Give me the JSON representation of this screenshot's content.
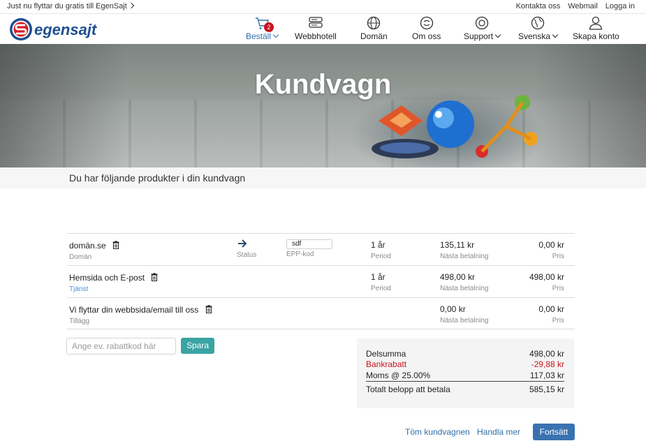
{
  "topbar": {
    "promo": "Just nu flyttar du gratis till EgenSajt",
    "links": [
      "Kontakta oss",
      "Webmail",
      "Logga in"
    ]
  },
  "brand": {
    "logo_text": "egensajt"
  },
  "nav": {
    "items": [
      {
        "label": "Beställ",
        "icon": "cart-icon",
        "badge": "2"
      },
      {
        "label": "Webbhotell",
        "icon": "server-icon"
      },
      {
        "label": "Domän",
        "icon": "globe-icon"
      },
      {
        "label": "Om oss",
        "icon": "chat-icon"
      },
      {
        "label": "Support",
        "icon": "lifebuoy-icon"
      },
      {
        "label": "Svenska",
        "icon": "world-icon"
      },
      {
        "label": "Skapa konto",
        "icon": "user-icon"
      }
    ]
  },
  "hero": {
    "title": "Kundvagn"
  },
  "subheader": "Du har följande produkter i din kundvagn",
  "cart": {
    "rows": [
      {
        "name": "domän.se",
        "type": "Domän",
        "status_label": "Status",
        "epp_value": "sdf",
        "epp_label": "EPP-kod",
        "period": "1 år",
        "period_label": "Period",
        "next_payment": "135,11 kr",
        "next_payment_label": "Nästa betalning",
        "price": "0,00 kr",
        "price_label": "Pris"
      },
      {
        "name": "Hemsida och E-post",
        "type": "Tjänst",
        "period": "1 år",
        "period_label": "Period",
        "next_payment": "498,00 kr",
        "next_payment_label": "Nästa betalning",
        "price": "498,00 kr",
        "price_label": "Pris"
      },
      {
        "name": "Vi flyttar din webbsida/email till oss",
        "type": "Tillägg",
        "next_payment": "0,00 kr",
        "next_payment_label": "Nästa betalning",
        "price": "0,00 kr",
        "price_label": "Pris"
      }
    ]
  },
  "discount": {
    "placeholder": "Ange ev. rabattkod här",
    "button": "Spara"
  },
  "totals": {
    "subtotal_label": "Delsumma",
    "subtotal": "498,00 kr",
    "discount_label": "Bankrabatt",
    "discount": "-29,88 kr",
    "vat_label": "Moms @ 25.00%",
    "vat": "117,03 kr",
    "total_label": "Totalt belopp att betala",
    "total": "585,15 kr"
  },
  "actions": {
    "empty": "Töm kundvagnen",
    "shop_more": "Handla mer",
    "continue": "Fortsätt"
  },
  "colors": {
    "accent": "#2f6ea8",
    "badge": "#c9141f",
    "teal": "#3aa3a3",
    "discount_red": "#c9141f",
    "primary_button": "#3a72b0"
  }
}
